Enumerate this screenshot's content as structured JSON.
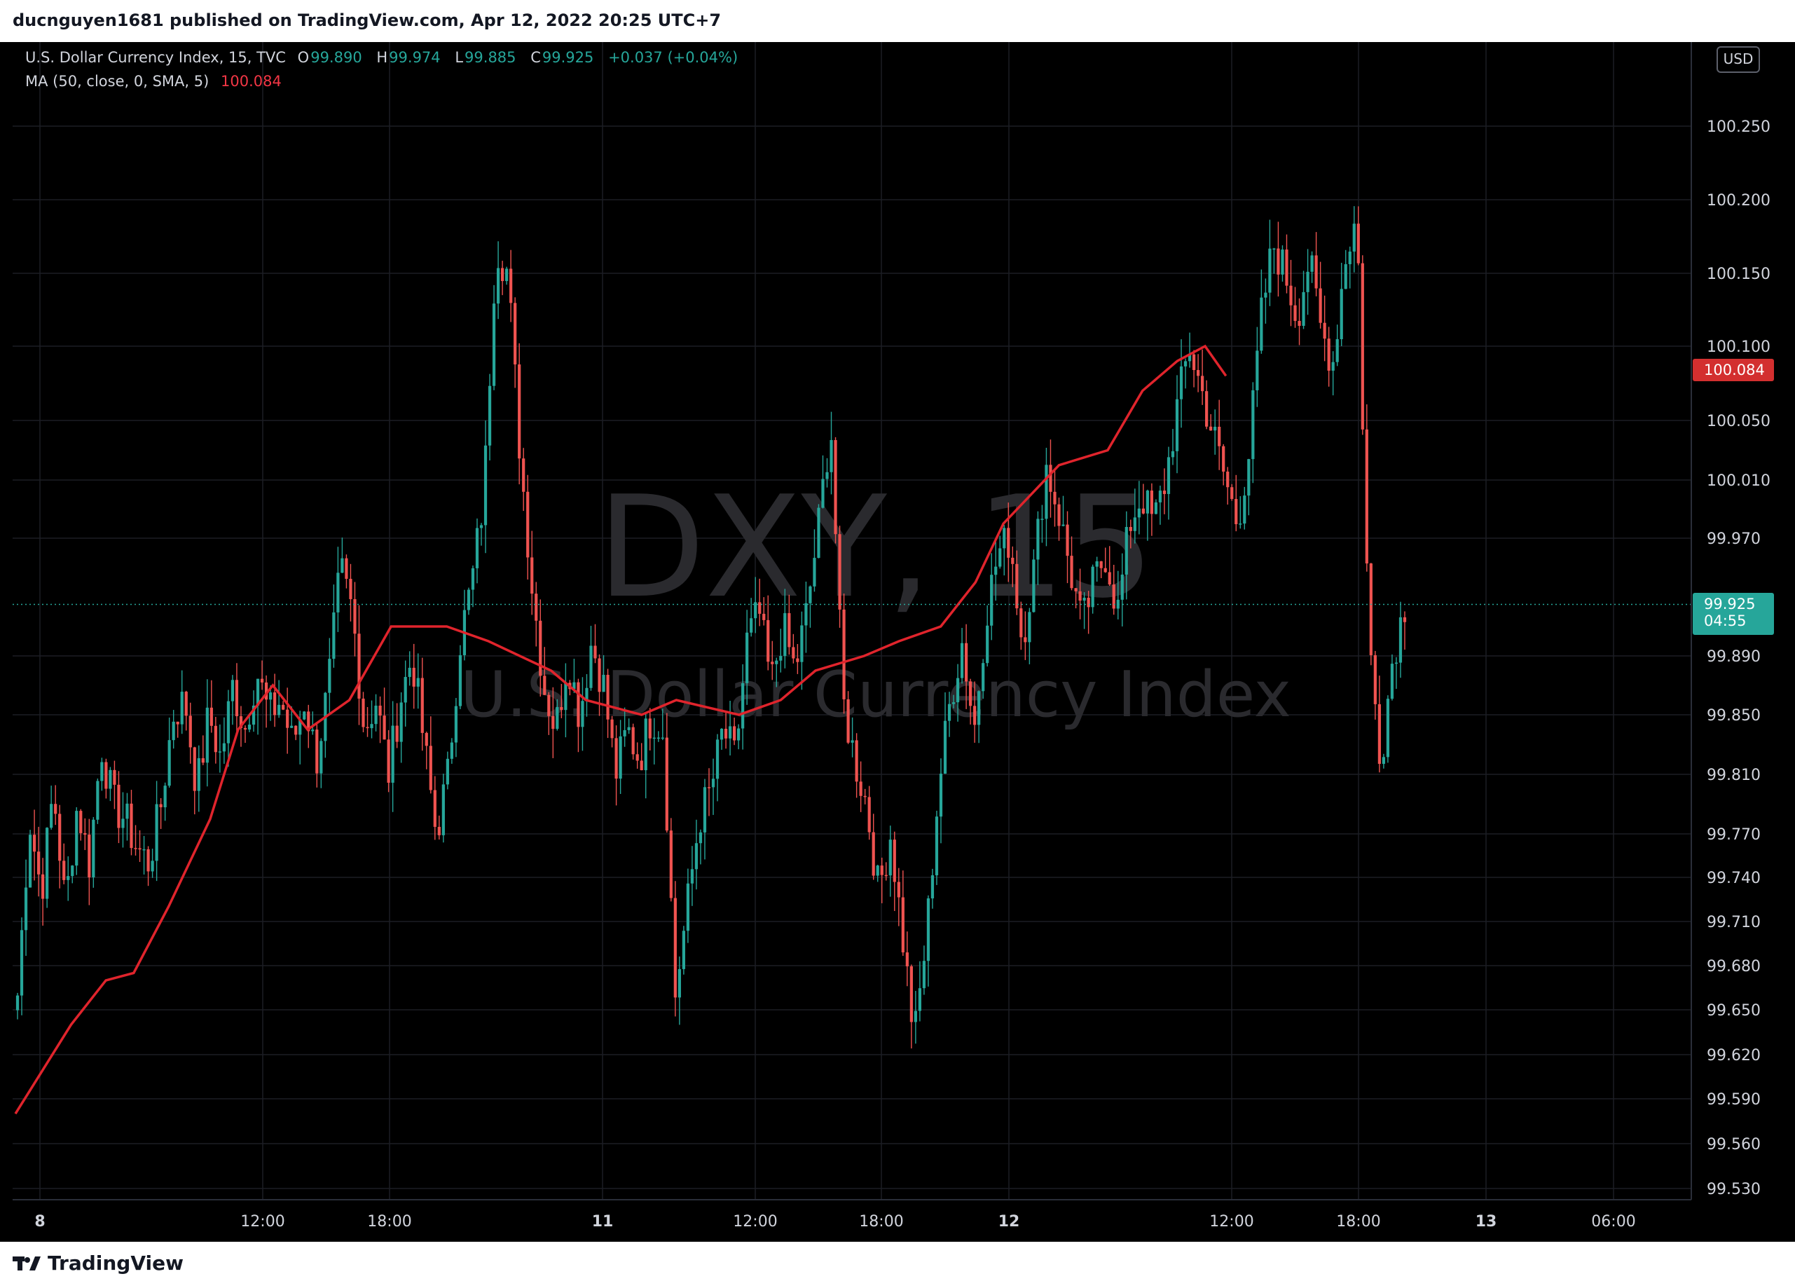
{
  "header": {
    "publish_text": "ducnguyen1681 published on TradingView.com, Apr 12, 2022 20:25 UTC+7"
  },
  "legend": {
    "symbol": "U.S. Dollar Currency Index, 15, TVC",
    "open_label": "O",
    "open": "99.890",
    "high_label": "H",
    "high": "99.974",
    "low_label": "L",
    "low": "99.885",
    "close_label": "C",
    "close": "99.925",
    "change": "+0.037 (+0.04%)",
    "ma_label": "MA (50, close, 0, SMA, 5)",
    "ma_value": "100.084"
  },
  "watermark": {
    "ticker": "DXY, 15",
    "name": "U.S. Dollar Currency Index"
  },
  "currency_badge": "USD",
  "price_tags": {
    "ma": "100.084",
    "last": "99.925",
    "countdown": "04:55"
  },
  "footer": {
    "brand": "TradingView"
  },
  "colors": {
    "up": "#26a69a",
    "down": "#ef5350",
    "ma": "#e0242c",
    "background": "#000000",
    "grid": "#1c1e24"
  },
  "chart_data": {
    "type": "candlestick",
    "ylim": [
      99.51,
      100.275
    ],
    "y_ticks": [
      "100.250",
      "100.200",
      "100.150",
      "100.100",
      "100.050",
      "100.010",
      "99.970",
      "99.890",
      "99.850",
      "99.810",
      "99.770",
      "99.740",
      "99.710",
      "99.680",
      "99.650",
      "99.620",
      "99.590",
      "99.560",
      "99.530"
    ],
    "x_ticks": [
      "8",
      "12:00",
      "18:00",
      "11",
      "12:00",
      "18:00",
      "12",
      "12:00",
      "18:00",
      "13",
      "06:00"
    ],
    "last_price": 99.925,
    "close_path": [
      99.66,
      99.78,
      99.73,
      99.8,
      99.72,
      99.79,
      99.75,
      99.83,
      99.79,
      99.78,
      99.76,
      99.75,
      99.79,
      99.85,
      99.86,
      99.8,
      99.85,
      99.82,
      99.87,
      99.84,
      99.88,
      99.85,
      99.86,
      99.83,
      99.86,
      99.82,
      99.87,
      99.95,
      99.92,
      99.84,
      99.86,
      99.81,
      99.86,
      99.89,
      99.83,
      99.77,
      99.81,
      99.9,
      99.94,
      100.0,
      100.17,
      100.15,
      100.03,
      99.94,
      99.87,
      99.84,
      99.89,
      99.85,
      99.9,
      99.87,
      99.81,
      99.84,
      99.82,
      99.85,
      99.84,
      99.66,
      99.72,
      99.78,
      99.8,
      99.84,
      99.82,
      99.9,
      99.92,
      99.87,
      99.91,
      99.88,
      99.92,
      99.98,
      100.05,
      99.86,
      99.82,
      99.79,
      99.73,
      99.77,
      99.7,
      99.63,
      99.7,
      99.8,
      99.86,
      99.9,
      99.84,
      99.92,
      99.96,
      99.97,
      99.9,
      99.95,
      100.02,
      99.99,
      99.95,
      99.91,
      99.94,
      99.96,
      99.92,
      99.98,
      100.0,
      99.98,
      100.01,
      100.06,
      100.1,
      100.07,
      100.04,
      100.01,
      99.98,
      100.03,
      100.12,
      100.17,
      100.15,
      100.12,
      100.16,
      100.11,
      100.09,
      100.16,
      100.19,
      99.9,
      99.82,
      99.89,
      99.925
    ],
    "ma_path": [
      [
        0,
        99.58
      ],
      [
        0.04,
        99.64
      ],
      [
        0.065,
        99.67
      ],
      [
        0.085,
        99.675
      ],
      [
        0.11,
        99.72
      ],
      [
        0.14,
        99.78
      ],
      [
        0.16,
        99.84
      ],
      [
        0.185,
        99.87
      ],
      [
        0.21,
        99.84
      ],
      [
        0.24,
        99.86
      ],
      [
        0.27,
        99.91
      ],
      [
        0.31,
        99.91
      ],
      [
        0.34,
        99.9
      ],
      [
        0.385,
        99.88
      ],
      [
        0.41,
        99.86
      ],
      [
        0.45,
        99.85
      ],
      [
        0.475,
        99.86
      ],
      [
        0.52,
        99.85
      ],
      [
        0.55,
        99.86
      ],
      [
        0.575,
        99.88
      ],
      [
        0.61,
        99.89
      ],
      [
        0.635,
        99.9
      ],
      [
        0.665,
        99.91
      ],
      [
        0.69,
        99.94
      ],
      [
        0.71,
        99.98
      ],
      [
        0.75,
        100.02
      ],
      [
        0.785,
        100.03
      ],
      [
        0.81,
        100.07
      ],
      [
        0.835,
        100.09
      ],
      [
        0.855,
        100.1
      ],
      [
        0.87,
        100.08
      ]
    ],
    "series": [
      {
        "name": "U.S. Dollar Currency Index",
        "type": "candlestick"
      },
      {
        "name": "MA (50, close, 0, SMA, 5)",
        "type": "line"
      }
    ]
  }
}
